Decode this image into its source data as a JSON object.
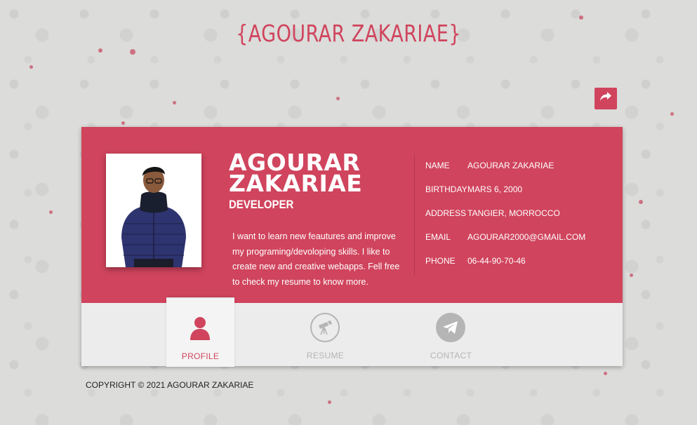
{
  "header": {
    "title": "{AGOURAR ZAKARIAE}"
  },
  "share": {
    "icon": "share-icon"
  },
  "profile": {
    "name_line1": "AGOURAR",
    "name_line2": "ZAKARIAE",
    "role": "DEVELOPER",
    "bio": "I want to learn new feautures and improve my programing/devoloping skills. I like to create new and creative webapps. Fell free to check my resume to know more.",
    "info": [
      {
        "label": "NAME",
        "value": "AGOURAR ZAKARIAE"
      },
      {
        "label": "BIRTHDAY",
        "value": "MARS 6, 2000"
      },
      {
        "label": "ADDRESS",
        "value": "TANGIER, MORROCCO"
      },
      {
        "label": "EMAIL",
        "value": "AGOURAR2000@GMAIL.COM"
      },
      {
        "label": "PHONE",
        "value": "06-44-90-70-46"
      }
    ]
  },
  "tabs": [
    {
      "label": "PROFILE",
      "icon": "user-icon",
      "active": true
    },
    {
      "label": "RESUME",
      "icon": "telescope-icon",
      "active": false
    },
    {
      "label": "CONTACT",
      "icon": "paper-plane-icon",
      "active": false
    }
  ],
  "footer": {
    "copyright": "COPYRIGHT © 2021 AGOURAR ZAKARIAE"
  },
  "colors": {
    "accent": "#d0445d",
    "tab_inactive": "#b5b5b5",
    "background": "#dcdcda"
  }
}
